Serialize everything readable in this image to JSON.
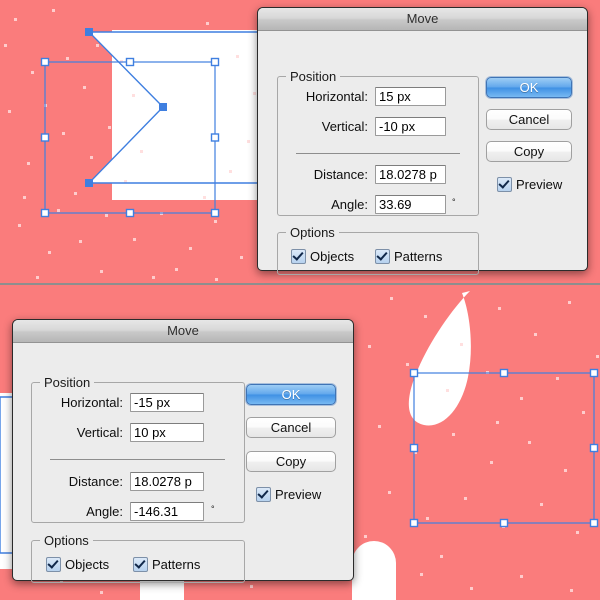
{
  "canvas": {
    "background_color": "#fa7c7c",
    "speckle_color": "#ffd9d9",
    "artwork_white": "#ffffff",
    "selection_color": "#3f7fe0"
  },
  "dialogs": [
    {
      "id": "move-dialog-top",
      "title": "Move",
      "position_group_label": "Position",
      "options_group_label": "Options",
      "fields": [
        {
          "name": "horizontal",
          "label": "Horizontal:",
          "value": "15 px"
        },
        {
          "name": "vertical",
          "label": "Vertical:",
          "value": "-10 px"
        },
        {
          "name": "distance",
          "label": "Distance:",
          "value": "18.0278 p"
        },
        {
          "name": "angle",
          "label": "Angle:",
          "value": "33.69"
        }
      ],
      "degree_symbol": "°",
      "buttons": [
        {
          "name": "ok",
          "label": "OK",
          "primary": true
        },
        {
          "name": "cancel",
          "label": "Cancel",
          "primary": false
        },
        {
          "name": "copy",
          "label": "Copy",
          "primary": false
        }
      ],
      "checkboxes": [
        {
          "name": "preview",
          "label": "Preview",
          "checked": true
        },
        {
          "name": "objects",
          "label": "Objects",
          "checked": true
        },
        {
          "name": "patterns",
          "label": "Patterns",
          "checked": true
        }
      ]
    },
    {
      "id": "move-dialog-bottom",
      "title": "Move",
      "position_group_label": "Position",
      "options_group_label": "Options",
      "fields": [
        {
          "name": "horizontal",
          "label": "Horizontal:",
          "value": "-15 px"
        },
        {
          "name": "vertical",
          "label": "Vertical:",
          "value": "10 px"
        },
        {
          "name": "distance",
          "label": "Distance:",
          "value": "18.0278 p"
        },
        {
          "name": "angle",
          "label": "Angle:",
          "value": "-146.31"
        }
      ],
      "degree_symbol": "°",
      "buttons": [
        {
          "name": "ok",
          "label": "OK",
          "primary": true
        },
        {
          "name": "cancel",
          "label": "Cancel",
          "primary": false
        },
        {
          "name": "copy",
          "label": "Copy",
          "primary": false
        }
      ],
      "checkboxes": [
        {
          "name": "preview",
          "label": "Preview",
          "checked": true
        },
        {
          "name": "objects",
          "label": "Objects",
          "checked": true
        },
        {
          "name": "patterns",
          "label": "Patterns",
          "checked": true
        }
      ]
    }
  ]
}
